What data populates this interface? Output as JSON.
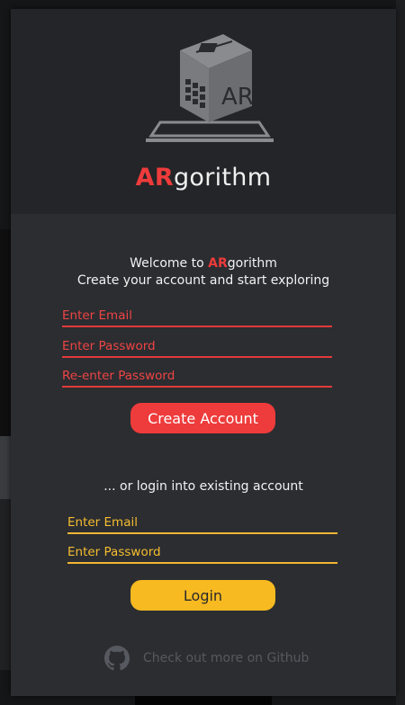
{
  "app": {
    "title_accent": "AR",
    "title_rest": "gorithm",
    "logo_text": "AR"
  },
  "signup": {
    "welcome_prefix": "Welcome to ",
    "welcome_accent": "AR",
    "welcome_rest": "gorithm",
    "tagline": "Create your account and start exploring",
    "email_placeholder": "Enter Email",
    "password_placeholder": "Enter Password",
    "reenter_placeholder": "Re-enter Password",
    "create_label": "Create Account"
  },
  "login": {
    "prompt": "... or login into existing account",
    "email_placeholder": "Enter Email",
    "password_placeholder": "Enter Password",
    "login_label": "Login"
  },
  "footer": {
    "github_text": "Check out more on Github"
  },
  "colors": {
    "accent_red": "#ee3b3b",
    "accent_gold": "#f8ba21",
    "modal_bg": "#2b2d31",
    "header_bg": "#242528"
  },
  "icons": {
    "logo": "ar-cube-logo",
    "github": "github-icon"
  }
}
